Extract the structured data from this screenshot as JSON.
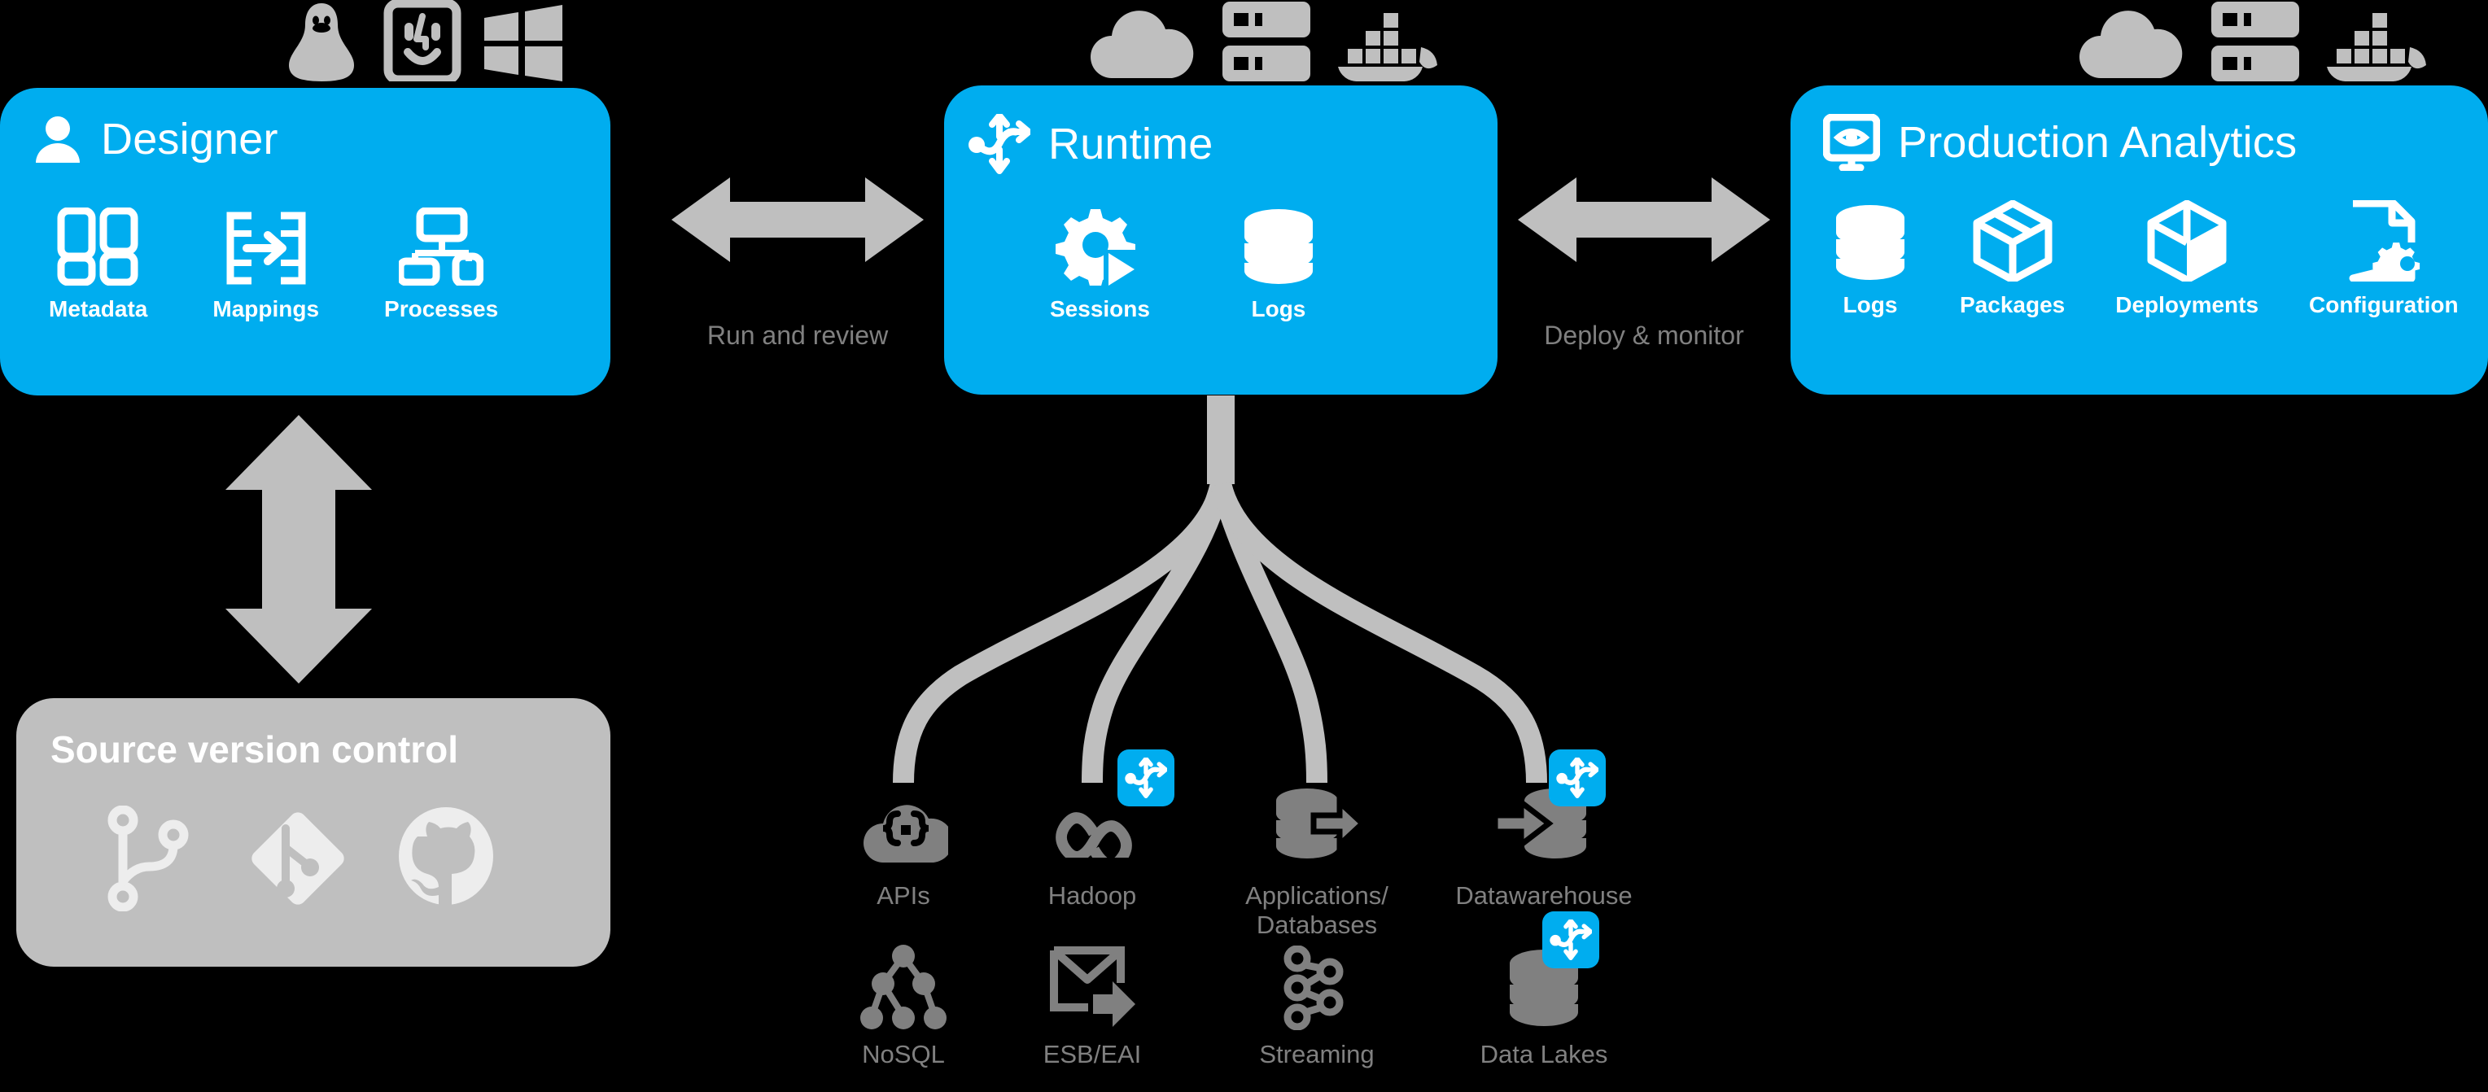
{
  "accent_color": "#00ADEF",
  "grey_color": "#BFBFBF",
  "label_grey": "#808080",
  "background": "#000000",
  "panels": {
    "designer": {
      "title": "Designer",
      "header_icon": "user-icon",
      "platform_icons": [
        "linux-tux-icon",
        "macos-finder-icon",
        "windows-icon"
      ],
      "features": [
        {
          "label": "Metadata",
          "icon": "metadata-columns-icon"
        },
        {
          "label": "Mappings",
          "icon": "mappings-arrow-icon"
        },
        {
          "label": "Processes",
          "icon": "processes-flow-icon"
        }
      ]
    },
    "runtime": {
      "title": "Runtime",
      "header_icon": "runtime-arrows-icon",
      "platform_icons": [
        "cloud-icon",
        "server-rack-icon",
        "docker-whale-icon"
      ],
      "features": [
        {
          "label": "Sessions",
          "icon": "gear-play-icon"
        },
        {
          "label": "Logs",
          "icon": "database-stack-icon"
        }
      ]
    },
    "production_analytics": {
      "title": "Production Analytics",
      "header_icon": "monitor-eye-icon",
      "platform_icons": [
        "cloud-icon",
        "server-rack-icon",
        "docker-whale-icon"
      ],
      "features": [
        {
          "label": "Logs",
          "icon": "database-stack-icon"
        },
        {
          "label": "Packages",
          "icon": "package-box-icon"
        },
        {
          "label": "Deployments",
          "icon": "deployment-box-icon"
        },
        {
          "label": "Configuration",
          "icon": "document-gear-icon"
        }
      ]
    },
    "source_version_control": {
      "title": "Source version control",
      "icons": [
        "git-branch-icon",
        "git-logo-icon",
        "github-icon"
      ]
    }
  },
  "connectors": [
    {
      "label": "Run and review",
      "name": "designer-runtime-arrow"
    },
    {
      "label": "Deploy & monitor",
      "name": "runtime-analytics-arrow"
    },
    {
      "label": "",
      "name": "designer-scm-arrow"
    }
  ],
  "data_sources": {
    "row1": [
      {
        "label": "APIs",
        "icon": "api-cloud-icon",
        "badge": false
      },
      {
        "label": "Hadoop",
        "icon": "hadoop-infinity-icon",
        "badge": true
      },
      {
        "label": "Applications/\nDatabases",
        "icon": "database-arrow-out-icon",
        "badge": false
      },
      {
        "label": "Datawarehouse",
        "icon": "database-arrow-in-icon",
        "badge": true
      }
    ],
    "row2": [
      {
        "label": "NoSQL",
        "icon": "nosql-tree-icon",
        "badge": false
      },
      {
        "label": "ESB/EAI",
        "icon": "envelope-arrow-icon",
        "badge": false
      },
      {
        "label": "Streaming",
        "icon": "streaming-nodes-icon",
        "badge": false
      },
      {
        "label": "Data Lakes",
        "icon": "datalake-database-icon",
        "badge": true
      }
    ],
    "badge_icon": "runtime-arrows-icon"
  }
}
